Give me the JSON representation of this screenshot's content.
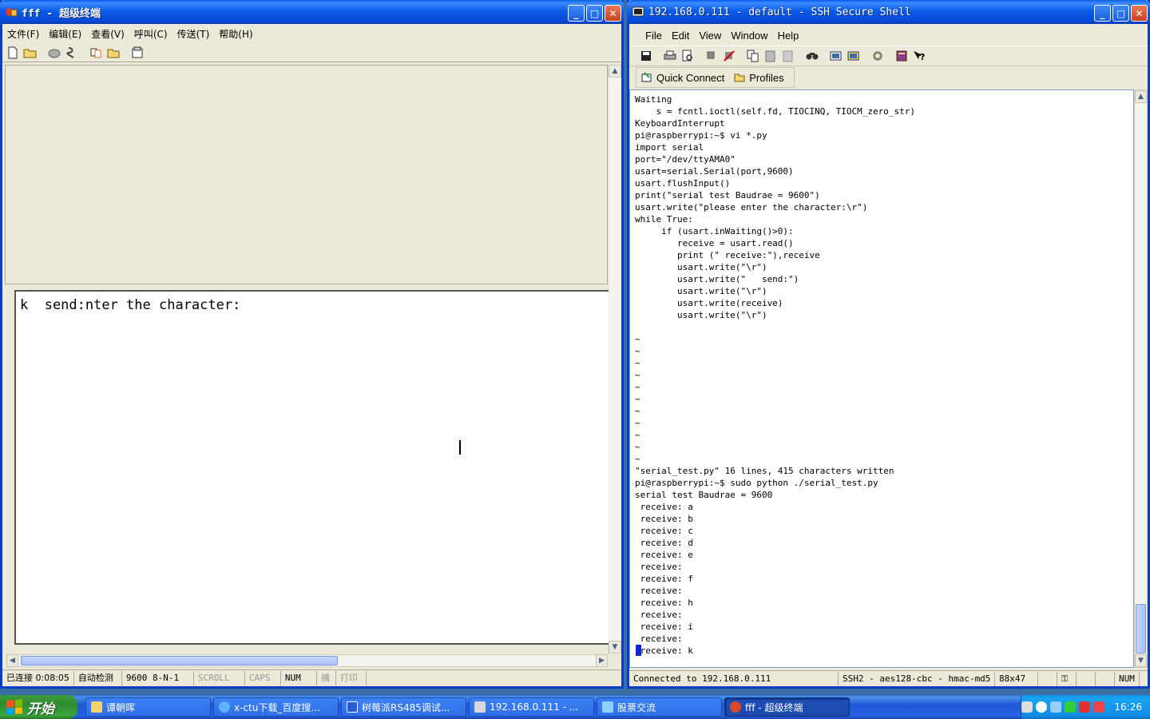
{
  "left_window": {
    "title": "fff - 超级终端",
    "menu": [
      "文件(F)",
      "编辑(E)",
      "查看(V)",
      "呼叫(C)",
      "传送(T)",
      "帮助(H)"
    ],
    "toolbar_icons": [
      "new-file-icon",
      "open-folder-icon",
      "call-icon",
      "disconnect-icon",
      "send-file-icon",
      "receive-file-icon",
      "properties-icon"
    ],
    "terminal_text": "k  send:nter the character:",
    "status": {
      "connection": "已连接 0:08:05",
      "detect": "自动检测",
      "params": "9600 8-N-1",
      "scroll": "SCROLL",
      "caps": "CAPS",
      "num": "NUM",
      "capture": "捕",
      "print": "打印"
    }
  },
  "right_window": {
    "title": "192.168.0.111 - default - SSH Secure Shell",
    "menu": [
      "File",
      "Edit",
      "View",
      "Window",
      "Help"
    ],
    "toolbar_icons": [
      "save-icon",
      "print-icon",
      "print-preview-icon",
      "connect-icon",
      "disconnect-icon",
      "copy-icon",
      "paste-icon",
      "paste-disabled-icon",
      "find-icon",
      "new-terminal-icon",
      "file-transfer-icon",
      "settings-icon",
      "help-book-icon",
      "context-help-icon"
    ],
    "quick_connect": "Quick Connect",
    "profiles": "Profiles",
    "terminal_lines": [
      "Waiting",
      "    s = fcntl.ioctl(self.fd, TIOCINQ, TIOCM_zero_str)",
      "KeyboardInterrupt",
      "pi@raspberrypi:~$ vi *.py",
      "import serial",
      "port=\"/dev/ttyAMA0\"",
      "usart=serial.Serial(port,9600)",
      "usart.flushInput()",
      "print(\"serial test Baudrae = 9600\")",
      "usart.write(\"please enter the character:\\r\")",
      "while True:",
      "     if (usart.inWaiting()>0):",
      "        receive = usart.read()",
      "        print (\" receive:\"),receive",
      "        usart.write(\"\\r\")",
      "        usart.write(\"   send:\")",
      "        usart.write(\"\\r\")",
      "        usart.write(receive)",
      "        usart.write(\"\\r\")",
      "",
      "~",
      "~",
      "~",
      "~",
      "~",
      "~",
      "~",
      "~",
      "~",
      "~",
      "~",
      "\"serial_test.py\" 16 lines, 415 characters written",
      "pi@raspberrypi:~$ sudo python ./serial_test.py",
      "serial test Baudrae = 9600",
      " receive: a",
      " receive: b",
      " receive: c",
      " receive: d",
      " receive: e",
      " receive:",
      " receive: f",
      " receive:",
      " receive: h",
      " receive:",
      " receive: i",
      " receive:",
      " receive: k"
    ],
    "status": {
      "connected": "Connected to 192.168.0.111",
      "cipher": "SSH2 - aes128-cbc - hmac-md5 - :",
      "size": "88x47",
      "num": "NUM"
    }
  },
  "taskbar": {
    "start": "开始",
    "tasks": [
      {
        "label": "谭朝晖",
        "icon": "folder-icon",
        "color": "#f3d36b"
      },
      {
        "label": "x-ctu下载_百度搜...",
        "icon": "ie-icon",
        "color": "#5fb2ff"
      },
      {
        "label": "树莓派RS485调试...",
        "icon": "word-icon",
        "color": "#2a5bd7"
      },
      {
        "label": "192.168.0.111 - ...",
        "icon": "ssh-icon",
        "color": "#d8d8d8"
      },
      {
        "label": "股票交流",
        "icon": "chat-icon",
        "color": "#8fd0ff"
      },
      {
        "label": "fff - 超级终端",
        "icon": "hyperterminal-icon",
        "color": "#d94a2b"
      }
    ],
    "time": "16:26"
  },
  "colors": {
    "title_blue": "#0b5ee9",
    "window_face": "#ece9d8",
    "ssh_cursor": "#0a28d8"
  }
}
